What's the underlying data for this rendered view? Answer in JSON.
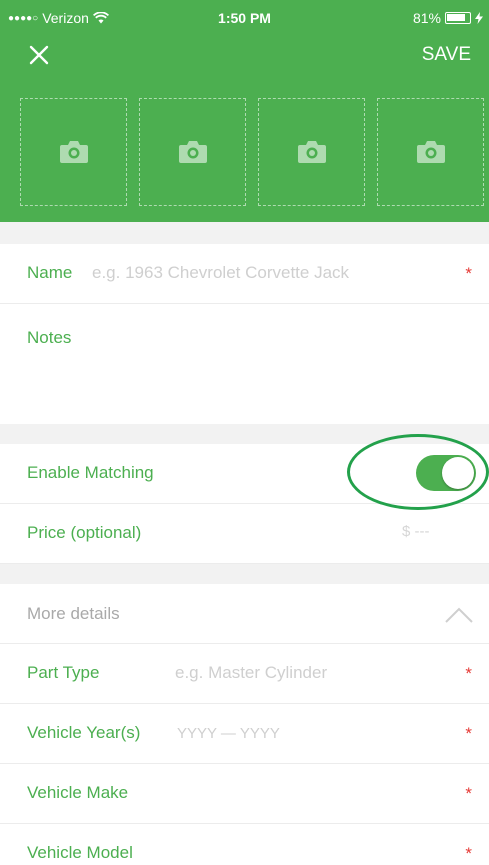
{
  "status_bar": {
    "carrier": "Verizon",
    "time": "1:50 PM",
    "battery": "81%"
  },
  "nav": {
    "save_label": "SAVE"
  },
  "photos": {
    "slot_count": 4
  },
  "form": {
    "name": {
      "label": "Name",
      "placeholder": "e.g. 1963 Chevrolet Corvette Jack",
      "required": "*"
    },
    "notes": {
      "label": "Notes"
    },
    "enable_matching": {
      "label": "Enable Matching",
      "enabled": true
    },
    "price": {
      "label": "Price (optional)",
      "value": "$ ---"
    },
    "more_details": {
      "label": "More details"
    },
    "part_type": {
      "label": "Part Type",
      "placeholder": "e.g. Master Cylinder",
      "required": "*"
    },
    "vehicle_years": {
      "label": "Vehicle Year(s)",
      "placeholder": "YYYY — YYYY",
      "required": "*"
    },
    "vehicle_make": {
      "label": "Vehicle Make",
      "required": "*"
    },
    "vehicle_model": {
      "label": "Vehicle Model",
      "required": "*"
    }
  },
  "colors": {
    "primary": "#4caf50",
    "required": "#e53935",
    "highlight": "#23a14b"
  }
}
